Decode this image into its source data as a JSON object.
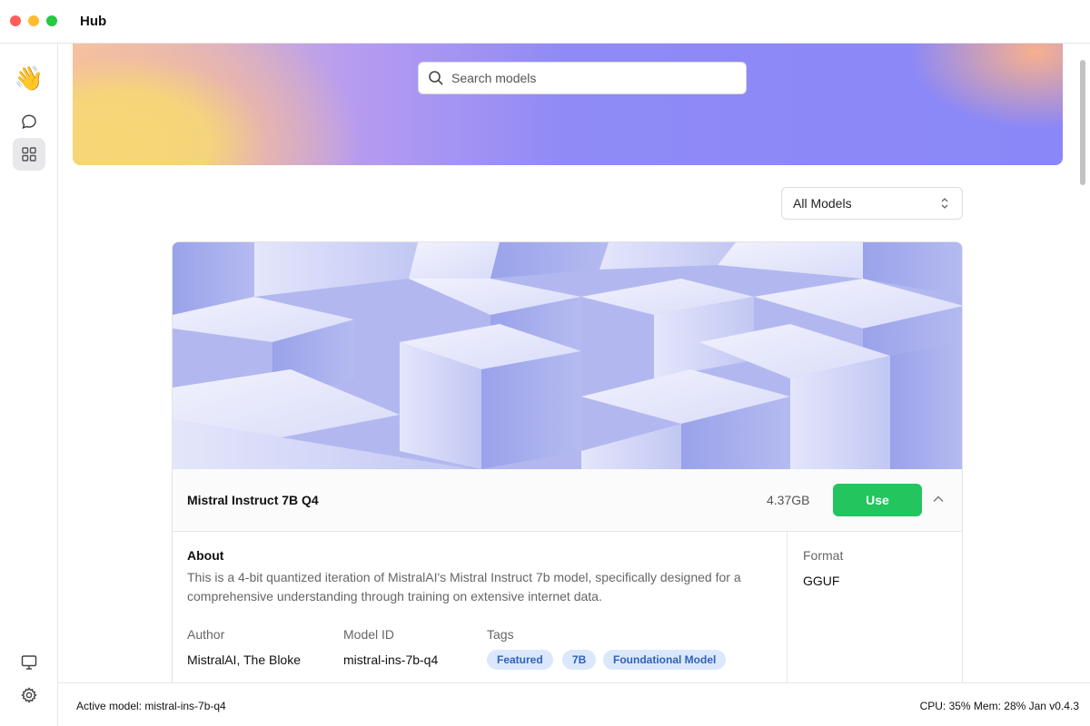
{
  "window": {
    "title": "Hub"
  },
  "sidebar": {
    "items": [
      {
        "name": "waving-hand-icon",
        "glyph": "👋"
      },
      {
        "name": "chat-bubble-icon"
      },
      {
        "name": "grid-icon"
      },
      {
        "name": "monitor-icon"
      },
      {
        "name": "gear-icon"
      }
    ]
  },
  "search": {
    "placeholder": "Search models"
  },
  "filter": {
    "selected": "All Models"
  },
  "model_card": {
    "name": "Mistral Instruct 7B Q4",
    "size": "4.37GB",
    "use_label": "Use",
    "about_title": "About",
    "about_text": "This is a 4-bit quantized iteration of MistralAI's Mistral Instruct 7b model, specifically designed for a comprehensive understanding through training on extensive internet data.",
    "author_label": "Author",
    "author_value": "MistralAI, The Bloke",
    "model_id_label": "Model ID",
    "model_id_value": "mistral-ins-7b-q4",
    "tags_label": "Tags",
    "tags": [
      "Featured",
      "7B",
      "Foundational Model"
    ],
    "format_label": "Format",
    "format_value": "GGUF"
  },
  "statusbar": {
    "active_model": "Active model: mistral-ins-7b-q4",
    "stats": "CPU: 35%  Mem: 28%  Jan v0.4.3"
  },
  "colors": {
    "accent_green": "#22c55e",
    "tag_bg": "#dbe7fb",
    "tag_text": "#2e63b8"
  }
}
